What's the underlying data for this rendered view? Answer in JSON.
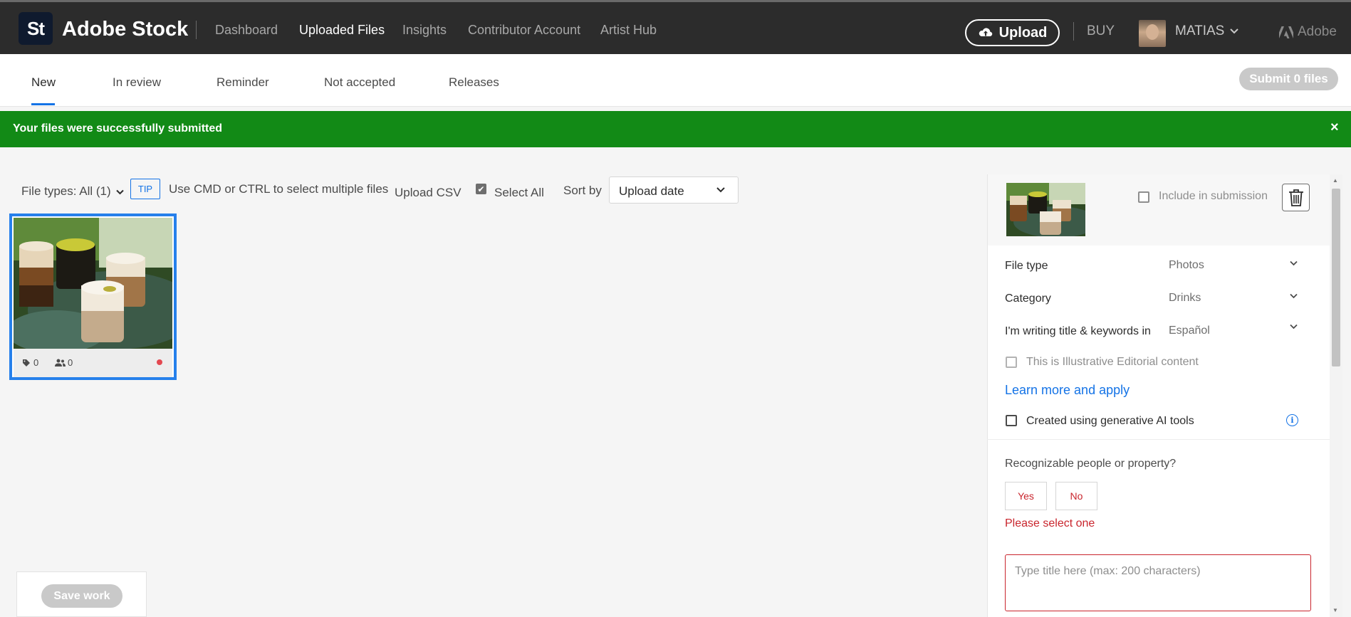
{
  "header": {
    "logo_text": "St",
    "brand": "Adobe Stock",
    "nav": [
      "Dashboard",
      "Uploaded Files",
      "Insights",
      "Contributor Account",
      "Artist Hub"
    ],
    "upload_label": "Upload",
    "buy_label": "BUY",
    "user_name": "MATIAS",
    "adobe_label": "Adobe"
  },
  "tabs": {
    "items": [
      "New",
      "In review",
      "Reminder",
      "Not accepted",
      "Releases"
    ],
    "active": "New",
    "submit_label": "Submit 0 files"
  },
  "alert": {
    "message": "Your files were successfully submitted",
    "close": "×"
  },
  "toolbar": {
    "file_types": "File types: All (1)",
    "tip_badge": "TIP",
    "tip_text": "Use CMD or CTRL to select multiple files",
    "upload_csv": "Upload CSV",
    "select_all": "Select All",
    "select_all_checked": true,
    "sort_by_label": "Sort by",
    "sort_value": "Upload date"
  },
  "thumbnail": {
    "keywords_count": "0",
    "releases_count": "0",
    "status_color": "#e34850"
  },
  "save": {
    "label": "Save work"
  },
  "panel": {
    "include_label": "Include in submission",
    "file_type_label": "File type",
    "file_type_value": "Photos",
    "category_label": "Category",
    "category_value": "Drinks",
    "language_label": "I'm writing title & keywords in",
    "language_value": "Español",
    "editorial_label": "This is Illustrative Editorial content",
    "learn_more": "Learn more and apply",
    "ai_label": "Created using generative AI tools",
    "info_icon": "i",
    "people_question": "Recognizable people or property?",
    "yes": "Yes",
    "no": "No",
    "error": "Please select one",
    "title_placeholder": "Type title here (max: 200 characters)"
  },
  "colors": {
    "topbar": "#2c2c2c",
    "accent": "#1473e6",
    "success": "#128a16",
    "error": "#c9252d"
  }
}
